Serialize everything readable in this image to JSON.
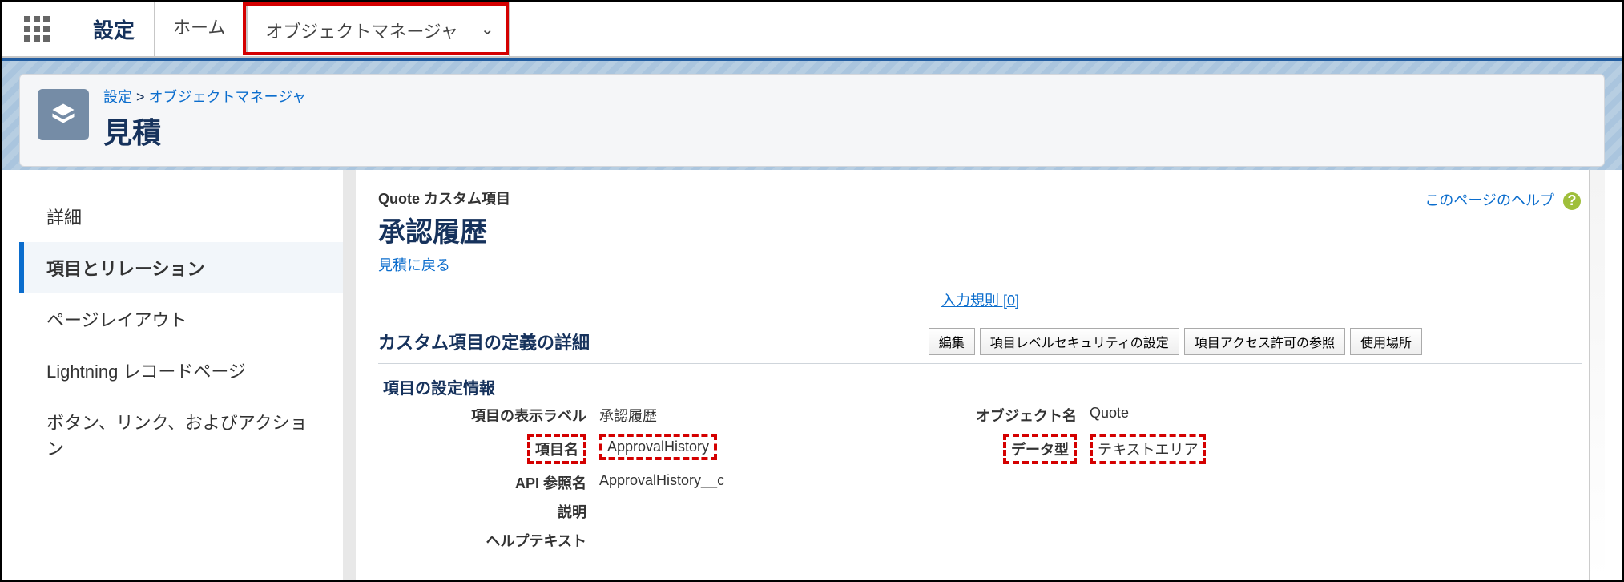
{
  "topnav": {
    "brand": "設定",
    "home": "ホーム",
    "object_manager": "オブジェクトマネージャ"
  },
  "breadcrumb": {
    "root": "設定",
    "parent": "オブジェクトマネージャ",
    "separator": ">"
  },
  "page_title": "見積",
  "sidebar": {
    "items": [
      "詳細",
      "項目とリレーション",
      "ページレイアウト",
      "Lightning レコードページ",
      "ボタン、リンク、およびアクション"
    ],
    "active_index": 1
  },
  "main": {
    "help_link": "このページのヘルプ",
    "overline": "Quote カスタム項目",
    "field_title": "承認履歴",
    "back_link": "見積に戻る",
    "validation_link": "入力規則 [0]",
    "section_title": "カスタム項目の定義の詳細",
    "buttons": [
      "編集",
      "項目レベルセキュリティの設定",
      "項目アクセス許可の参照",
      "使用場所"
    ],
    "subheader": "項目の設定情報",
    "details": {
      "label_field_label": "項目の表示ラベル",
      "value_field_label": "承認履歴",
      "label_object_name": "オブジェクト名",
      "value_object_name": "Quote",
      "label_field_name": "項目名",
      "value_field_name": "ApprovalHistory",
      "label_data_type": "データ型",
      "value_data_type": "テキストエリア",
      "label_api_name": "API 参照名",
      "value_api_name": "ApprovalHistory__c",
      "label_description": "説明",
      "label_help_text": "ヘルプテキスト"
    }
  }
}
